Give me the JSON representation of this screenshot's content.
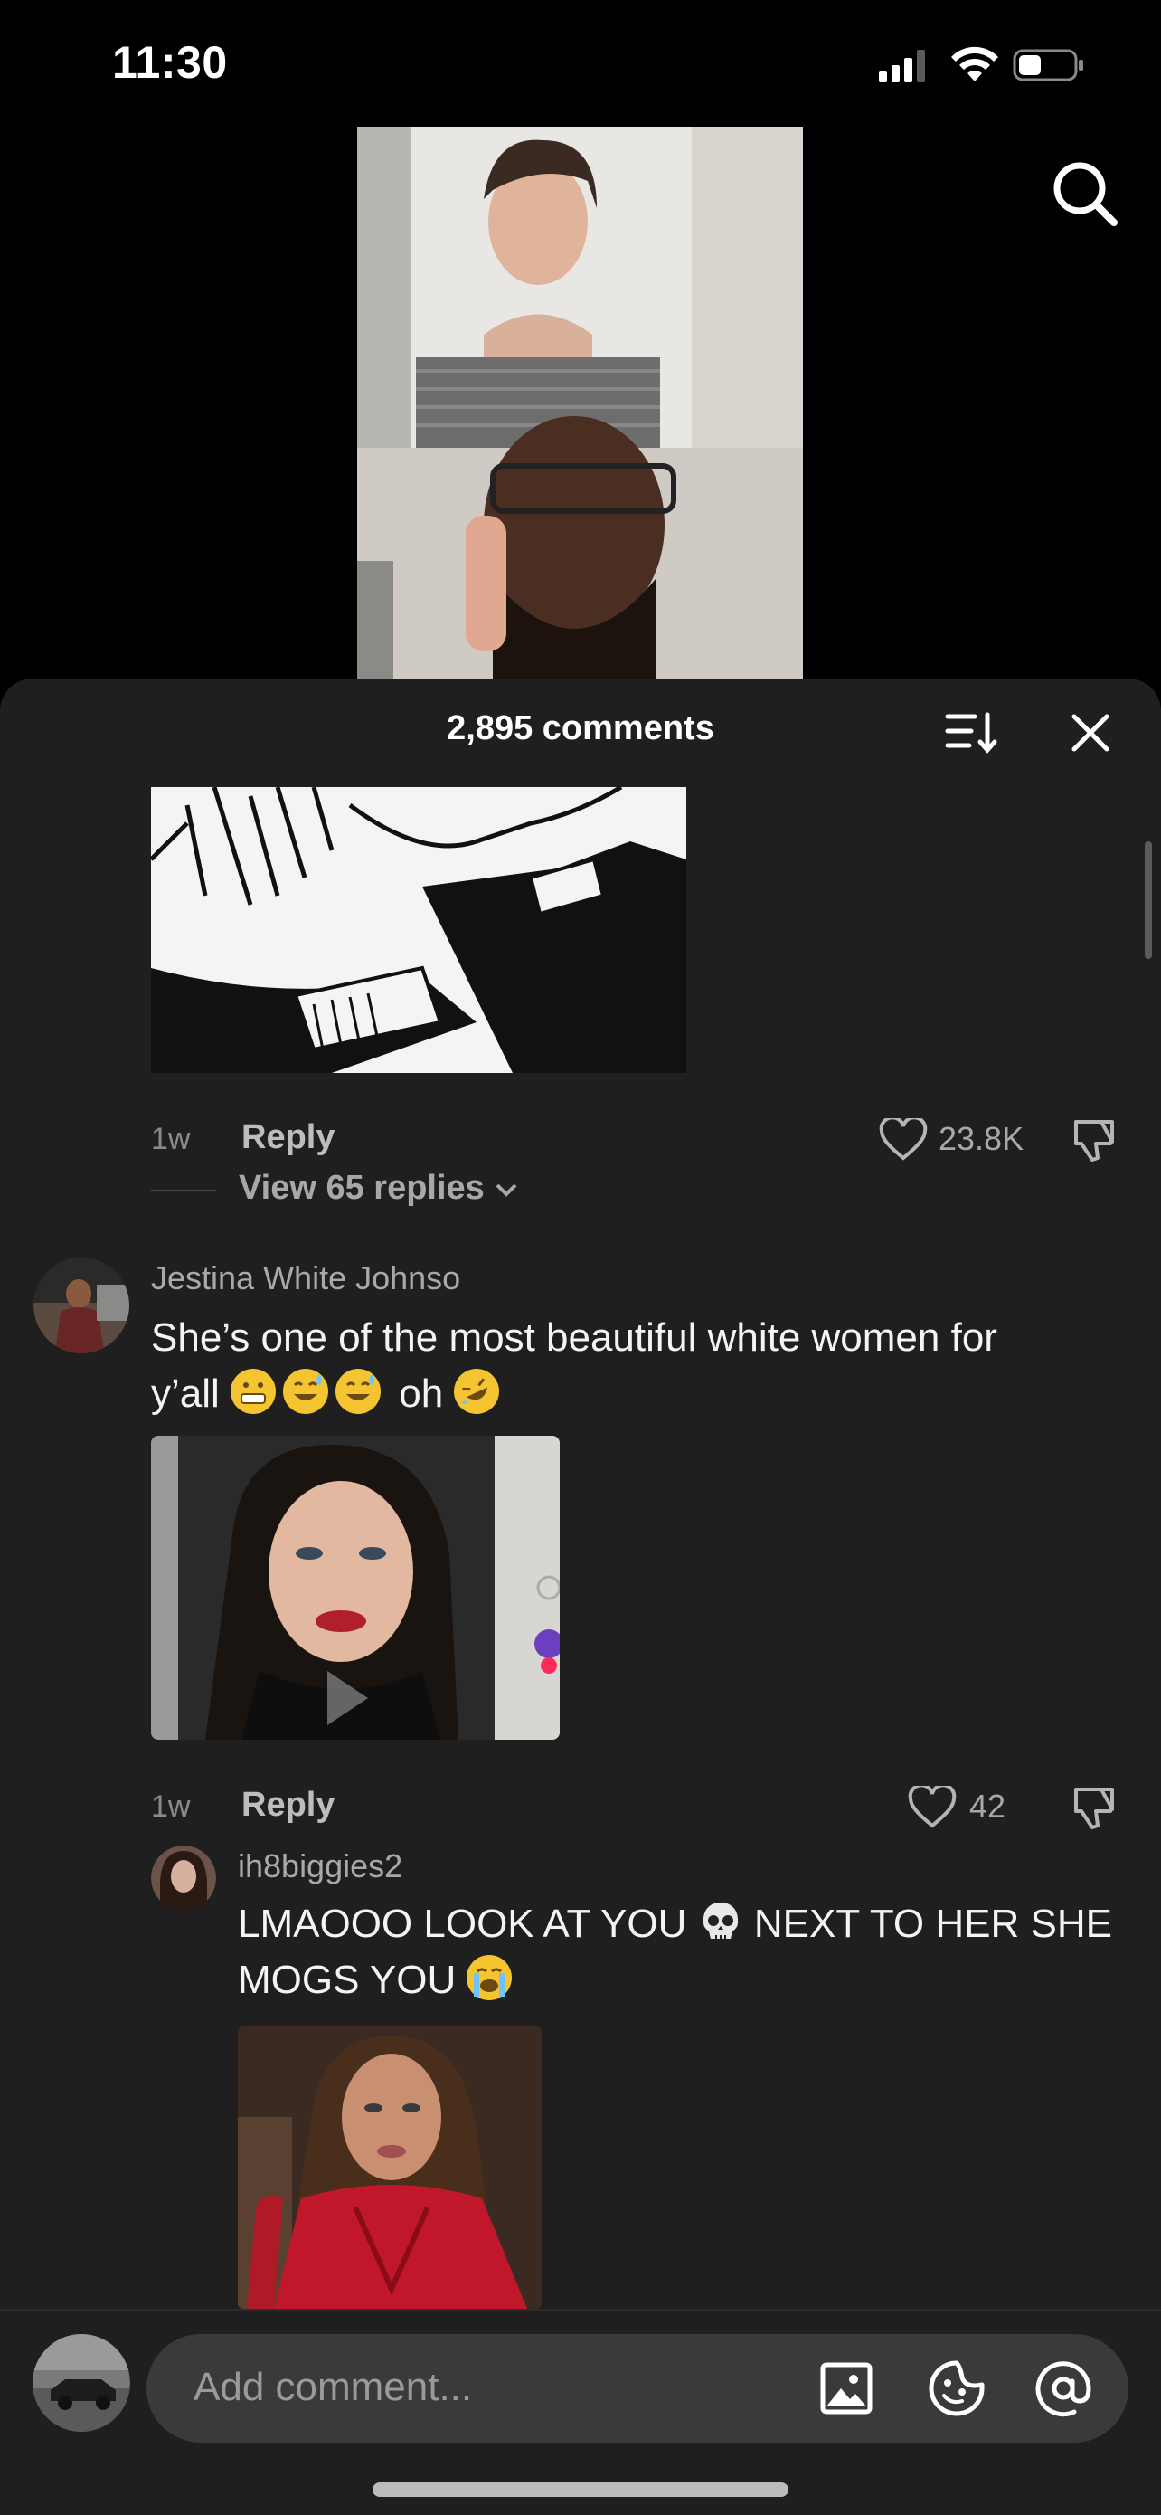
{
  "status_bar": {
    "time": "11:30"
  },
  "comments_panel": {
    "title": "2,895 comments",
    "top_comment": {
      "age": "1w",
      "reply_label": "Reply",
      "likes": "23.8K",
      "view_replies": "View 65 replies"
    },
    "comment": {
      "username": "Jestina White Johnso",
      "text_line1": "She’s one of the most beautiful white women for",
      "text_line2_word": "y’all",
      "text_line2_oh": "oh",
      "age": "1w",
      "reply_label": "Reply",
      "likes": "42"
    },
    "reply": {
      "username": "ih8biggies2",
      "text_line1_a": "LMAOOO LOOK AT YOU",
      "text_line1_b": "NEXT TO HER SHE",
      "text_line2": "MOGS YOU"
    }
  },
  "composer": {
    "placeholder": "Add comment..."
  },
  "icons": [
    "search-icon",
    "sort-icon",
    "close-icon",
    "heart-icon",
    "dislike-icon",
    "chevron-down-icon",
    "image-icon",
    "sticker-icon",
    "mention-icon",
    "signal-icon",
    "wifi-icon",
    "battery-icon"
  ]
}
